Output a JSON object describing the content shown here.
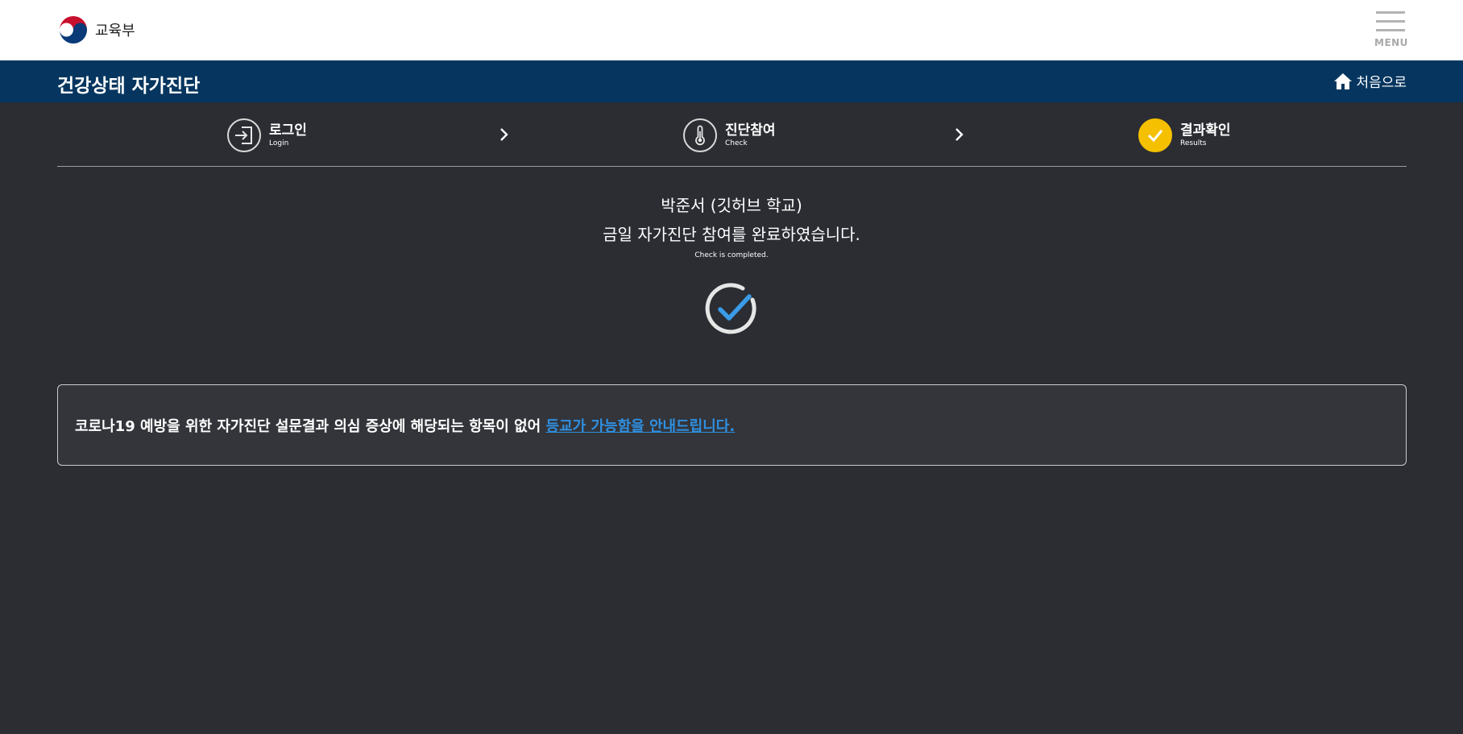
{
  "header": {
    "logo_text": "교육부",
    "menu_label": "MENU"
  },
  "titlebar": {
    "title": "건강상태 자가진단",
    "home_label": "처음으로"
  },
  "steps": [
    {
      "label": "로그인",
      "sub": "Login",
      "icon": "login-icon",
      "active": false
    },
    {
      "label": "진단참여",
      "sub": "Check",
      "icon": "thermometer-icon",
      "active": false
    },
    {
      "label": "결과확인",
      "sub": "Results",
      "icon": "check-icon",
      "active": true
    }
  ],
  "result": {
    "name": "박준서 (깃허브 학교)",
    "message": "금일 자가진단 참여를 완료하였습니다.",
    "sub": "Check is completed."
  },
  "notice": {
    "text": "코로나19 예방을 위한 자가진단 설문결과 의심 증상에 해당되는 항목이 없어 ",
    "link": "등교가 가능함을 안내드립니다."
  },
  "colors": {
    "background": "#2b2d33",
    "titlebar": "#06365f",
    "active_step": "#f5c000",
    "link": "#2f8fe0",
    "check_stroke": "#3a9be8"
  }
}
